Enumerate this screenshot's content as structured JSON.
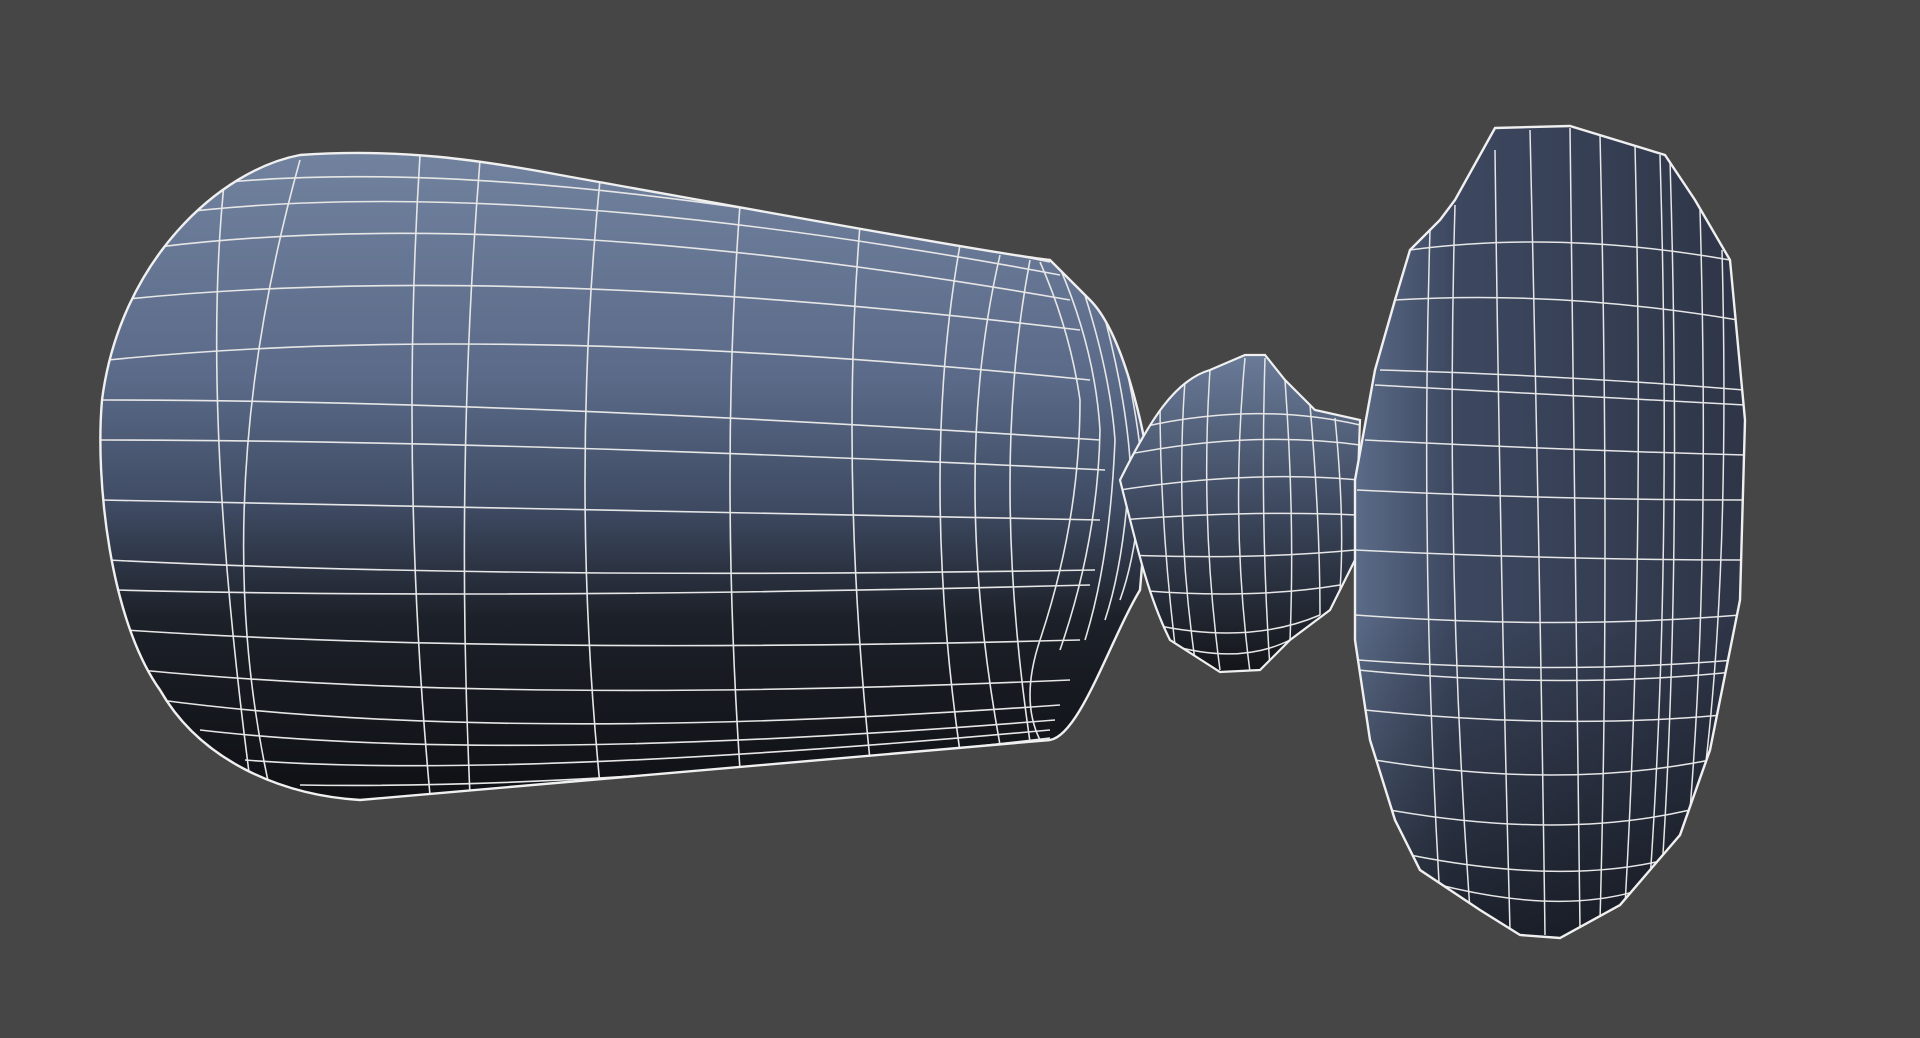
{
  "viewport": {
    "background_color": "#464646",
    "shading_mode": "wireframe-on-shaded",
    "object": {
      "name": "",
      "parts": [
        "handle-body",
        "neck",
        "knob-cap"
      ],
      "shade_light_color": "#6d7f9f",
      "shade_mid_color": "#3f4a60",
      "shade_dark_color": "#121418",
      "wire_color": "#e6e6e6"
    }
  }
}
